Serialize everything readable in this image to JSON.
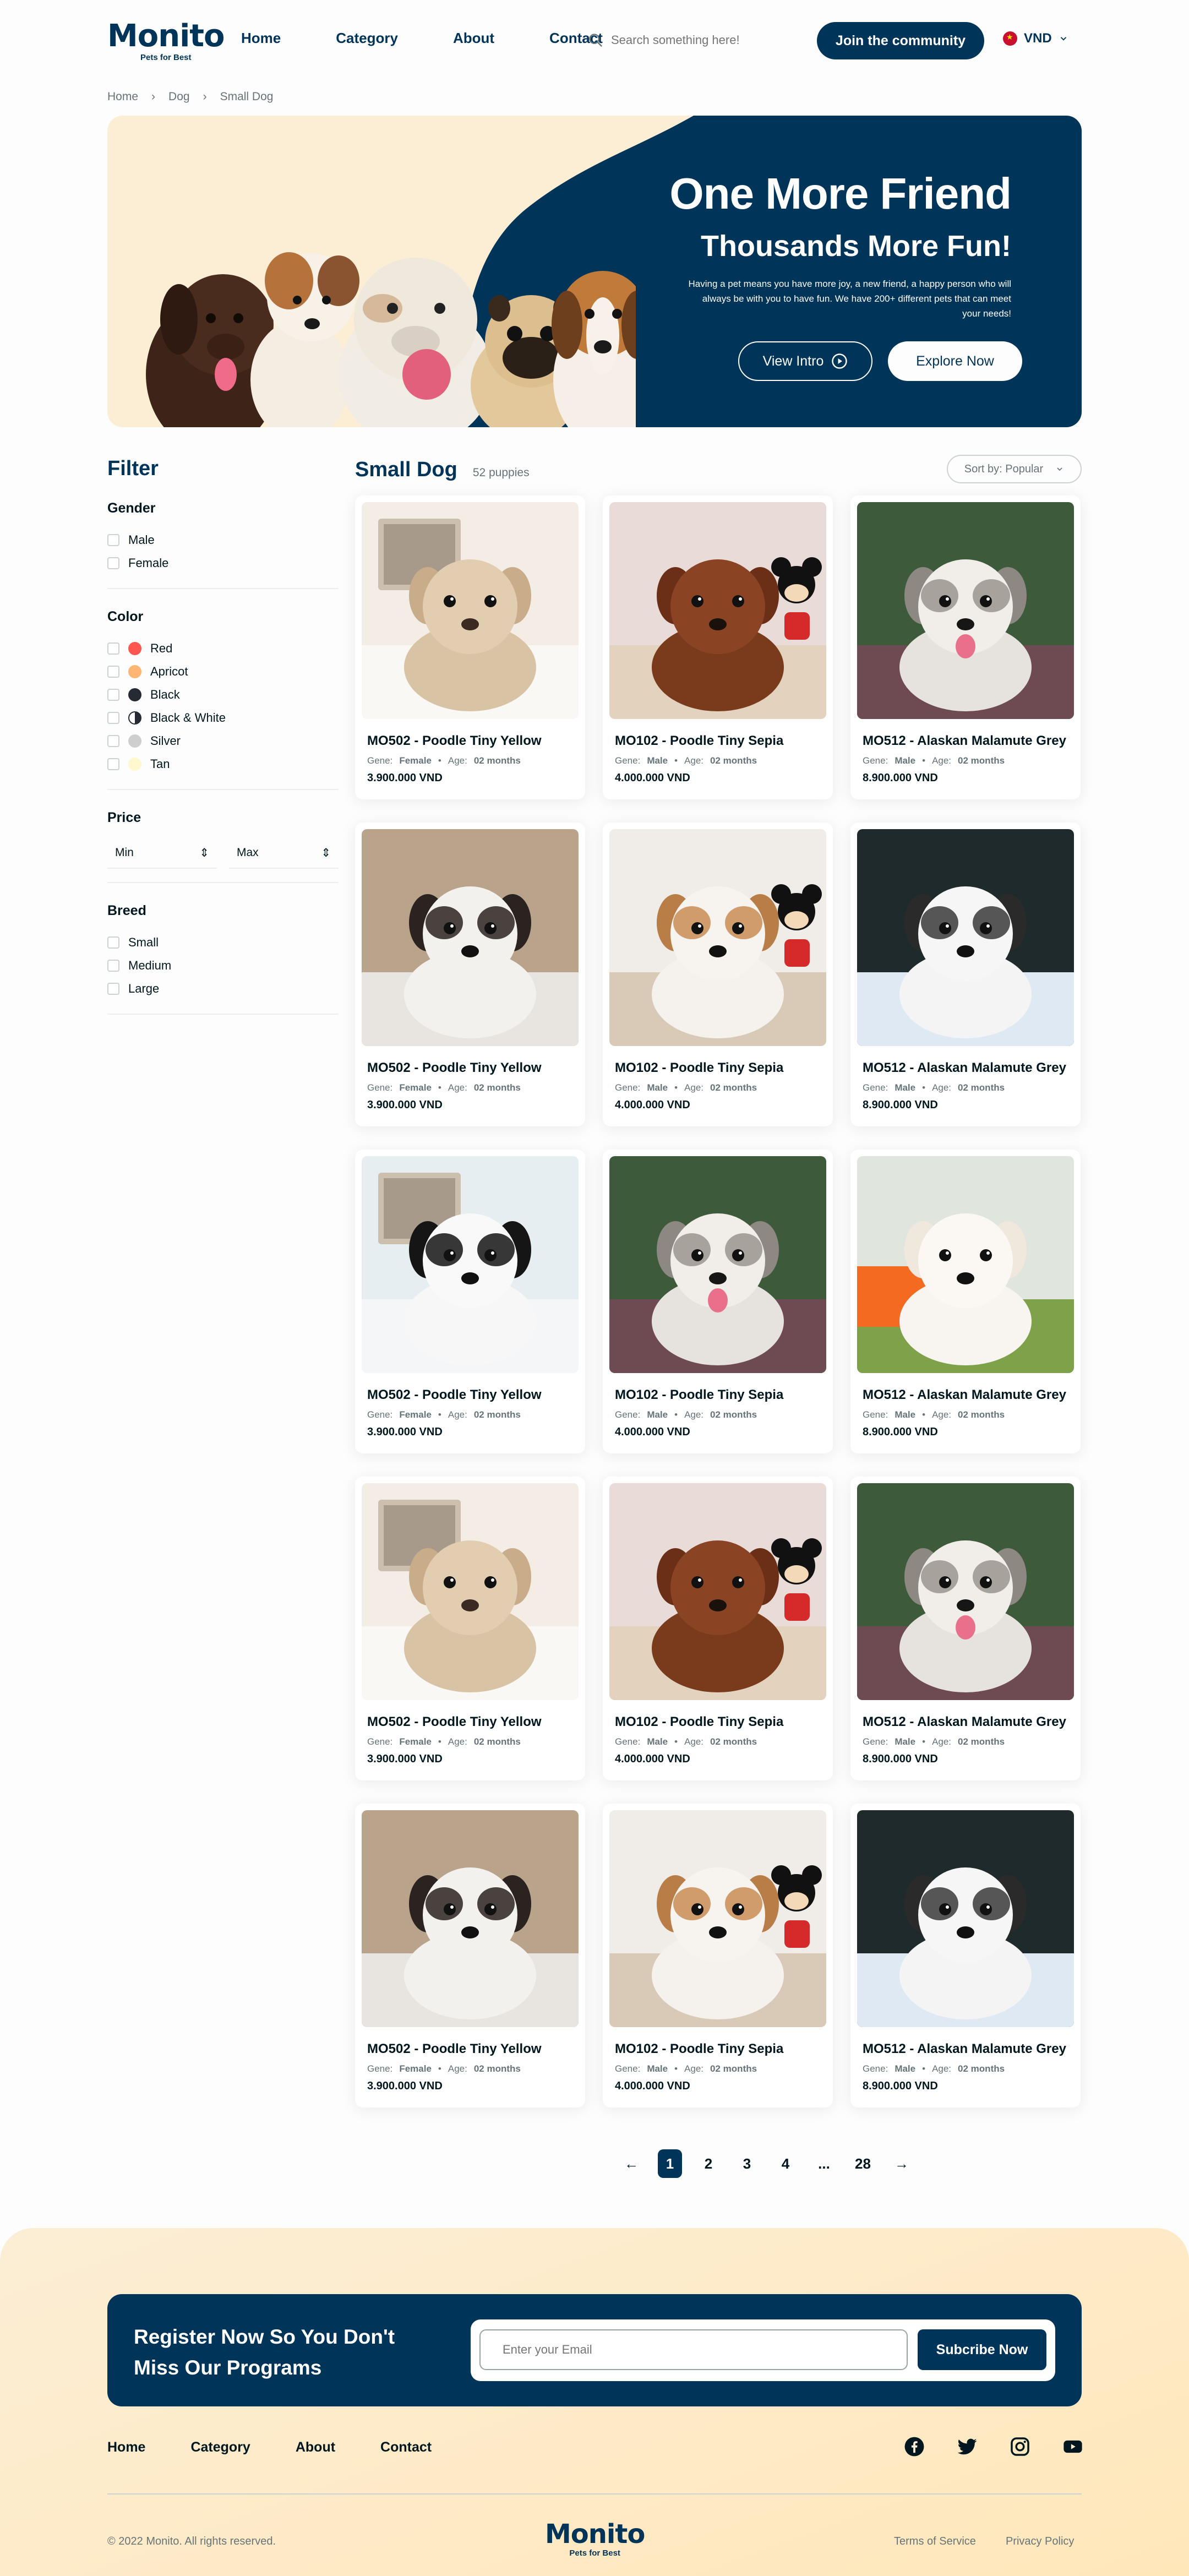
{
  "header": {
    "logo": "Monito",
    "logo_tag": "Pets for Best",
    "nav": [
      "Home",
      "Category",
      "About",
      "Contact"
    ],
    "search_placeholder": "Search something here!",
    "join_label": "Join the community",
    "currency": "VND"
  },
  "breadcrumb": [
    "Home",
    "Dog",
    "Small Dog"
  ],
  "banner": {
    "title": "One More Friend",
    "subtitle": "Thousands More Fun!",
    "description": "Having a pet means you have more joy, a new friend, a happy person who will always be with you to have fun. We have 200+ different pets that can meet your needs!",
    "intro_label": "View Intro",
    "explore_label": "Explore Now",
    "colors": {
      "navy": "#003459",
      "cream": "#fceed5"
    }
  },
  "filter": {
    "title": "Filter",
    "gender": {
      "label": "Gender",
      "options": [
        "Male",
        "Female"
      ]
    },
    "color": {
      "label": "Color",
      "options": [
        {
          "name": "Red",
          "swatch": "#ff564f"
        },
        {
          "name": "Apricot",
          "swatch": "#ffb672"
        },
        {
          "name": "Black",
          "swatch": "#242b33"
        },
        {
          "name": "Black & White",
          "swatch": "#242b33"
        },
        {
          "name": "Silver",
          "swatch": "#cecece"
        },
        {
          "name": "Tan",
          "swatch": "#fff7ce"
        }
      ]
    },
    "price": {
      "label": "Price",
      "min": "Min",
      "max": "Max"
    },
    "breed": {
      "label": "Breed",
      "options": [
        "Small",
        "Medium",
        "Large"
      ]
    }
  },
  "listing": {
    "title": "Small Dog",
    "count": "52 puppies",
    "sort": "Sort by: Popular",
    "gene_label": "Gene:",
    "age_label": "Age:",
    "products": [
      {
        "name": "MO502 - Poodle Tiny Yellow",
        "gene": "Female",
        "age": "02 months",
        "price": "3.900.000 VND",
        "photo": "poodle-cream"
      },
      {
        "name": "MO102 - Poodle Tiny Sepia",
        "gene": "Male",
        "age": "02 months",
        "price": "4.000.000 VND",
        "photo": "poodle-brown"
      },
      {
        "name": "MO512 - Alaskan Malamute Grey",
        "gene": "Male",
        "age": "02 months",
        "price": "8.900.000 VND",
        "photo": "malamute"
      },
      {
        "name": "MO502 - Poodle Tiny Yellow",
        "gene": "Female",
        "age": "02 months",
        "price": "3.900.000 VND",
        "photo": "corgi-tricolor"
      },
      {
        "name": "MO102 - Poodle Tiny Sepia",
        "gene": "Male",
        "age": "02 months",
        "price": "4.000.000 VND",
        "photo": "corgi-tan"
      },
      {
        "name": "MO512 - Alaskan Malamute Grey",
        "gene": "Male",
        "age": "02 months",
        "price": "8.900.000 VND",
        "photo": "pomeranian-bw"
      },
      {
        "name": "MO502 - Poodle Tiny Yellow",
        "gene": "Female",
        "age": "02 months",
        "price": "3.900.000 VND",
        "photo": "shihtzu-bw"
      },
      {
        "name": "MO102 - Poodle Tiny Sepia",
        "gene": "Male",
        "age": "02 months",
        "price": "4.000.000 VND",
        "photo": "malamute"
      },
      {
        "name": "MO512 - Alaskan Malamute Grey",
        "gene": "Male",
        "age": "02 months",
        "price": "8.900.000 VND",
        "photo": "pomeranian-white"
      },
      {
        "name": "MO502 - Poodle Tiny Yellow",
        "gene": "Female",
        "age": "02 months",
        "price": "3.900.000 VND",
        "photo": "poodle-cream"
      },
      {
        "name": "MO102 - Poodle Tiny Sepia",
        "gene": "Male",
        "age": "02 months",
        "price": "4.000.000 VND",
        "photo": "poodle-brown"
      },
      {
        "name": "MO512 - Alaskan Malamute Grey",
        "gene": "Male",
        "age": "02 months",
        "price": "8.900.000 VND",
        "photo": "malamute"
      },
      {
        "name": "MO502 - Poodle Tiny Yellow",
        "gene": "Female",
        "age": "02 months",
        "price": "3.900.000 VND",
        "photo": "corgi-tricolor"
      },
      {
        "name": "MO102 - Poodle Tiny Sepia",
        "gene": "Male",
        "age": "02 months",
        "price": "4.000.000 VND",
        "photo": "corgi-tan"
      },
      {
        "name": "MO512 - Alaskan Malamute Grey",
        "gene": "Male",
        "age": "02 months",
        "price": "8.900.000 VND",
        "photo": "pomeranian-bw"
      }
    ]
  },
  "pagination": {
    "pages": [
      "1",
      "2",
      "3",
      "4",
      "...",
      "28"
    ],
    "current": "1"
  },
  "footer": {
    "register_title": "Register Now So You Don't Miss Our Programs",
    "email_placeholder": "Enter your Email",
    "subscribe_label": "Subcribe Now",
    "nav": [
      "Home",
      "Category",
      "About",
      "Contact"
    ],
    "social": [
      "facebook-icon",
      "twitter-icon",
      "instagram-icon",
      "youtube-icon"
    ],
    "copyright": "© 2022 Monito. All rights reserved.",
    "links": [
      "Terms of Service",
      "Privacy Policy"
    ]
  }
}
